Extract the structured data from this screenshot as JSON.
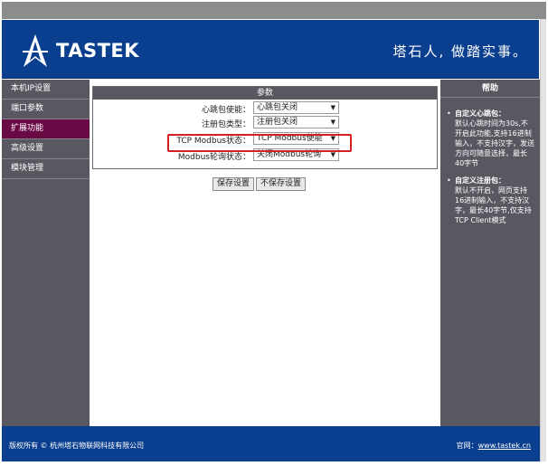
{
  "header": {
    "logo_text": "TASTEK",
    "slogan": "塔石人, 做踏实事。"
  },
  "sidebar": {
    "items": [
      {
        "label": "本机IP设置"
      },
      {
        "label": "端口参数"
      },
      {
        "label": "扩展功能",
        "active": true
      },
      {
        "label": "高级设置"
      },
      {
        "label": "模块管理"
      }
    ]
  },
  "panel": {
    "title": "参数",
    "rows": [
      {
        "label": "心跳包使能：",
        "value": "心跳包关闭"
      },
      {
        "label": "注册包类型：",
        "value": "注册包关闭"
      },
      {
        "label": "TCP Modbus状态：",
        "value": "TCP Modbus使能"
      },
      {
        "label": "Modbus轮询状态：",
        "value": "关闭Modbus轮询"
      }
    ]
  },
  "buttons": {
    "save": "保存设置",
    "discard": "不保存设置"
  },
  "help": {
    "title": "帮助",
    "items": [
      {
        "bullet": "•",
        "heading": "自定义心跳包：",
        "text": "默认心跳时间为30s,不开启此功能,支持16进制输入，不支持汉字，发送方向可随意选择，最长40字节"
      },
      {
        "bullet": "•",
        "heading": "自定义注册包：",
        "text": "默认不开启，网页支持16进制输入，不支持汉字，最长40字节,仅支持TCP Client模式"
      }
    ]
  },
  "footer": {
    "copyright": "版权所有 © 杭州塔石物联网科技有限公司",
    "site_label": "官网：",
    "site_link": "www.tastek.cn"
  },
  "colors": {
    "header_blue": "#0a3e8e",
    "sidebar_gray": "#595861",
    "active_item": "#6a0a45",
    "highlight_red": "#d42020"
  }
}
